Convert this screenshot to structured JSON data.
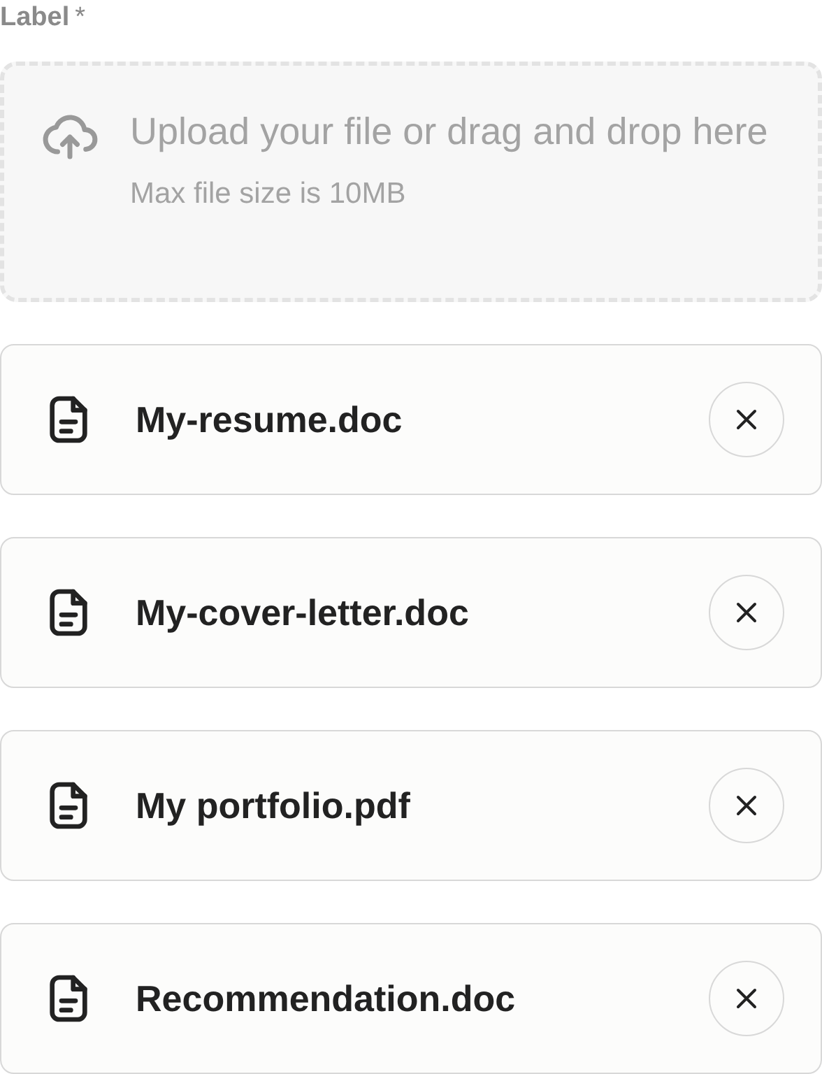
{
  "field": {
    "label": "Label",
    "required_mark": "*"
  },
  "dropzone": {
    "prompt": "Upload your file or drag and drop here",
    "hint": "Max file size is 10MB"
  },
  "files": [
    {
      "name": "My-resume.doc"
    },
    {
      "name": "My-cover-letter.doc"
    },
    {
      "name": "My portfolio.pdf"
    },
    {
      "name": "Recommendation.doc"
    }
  ]
}
